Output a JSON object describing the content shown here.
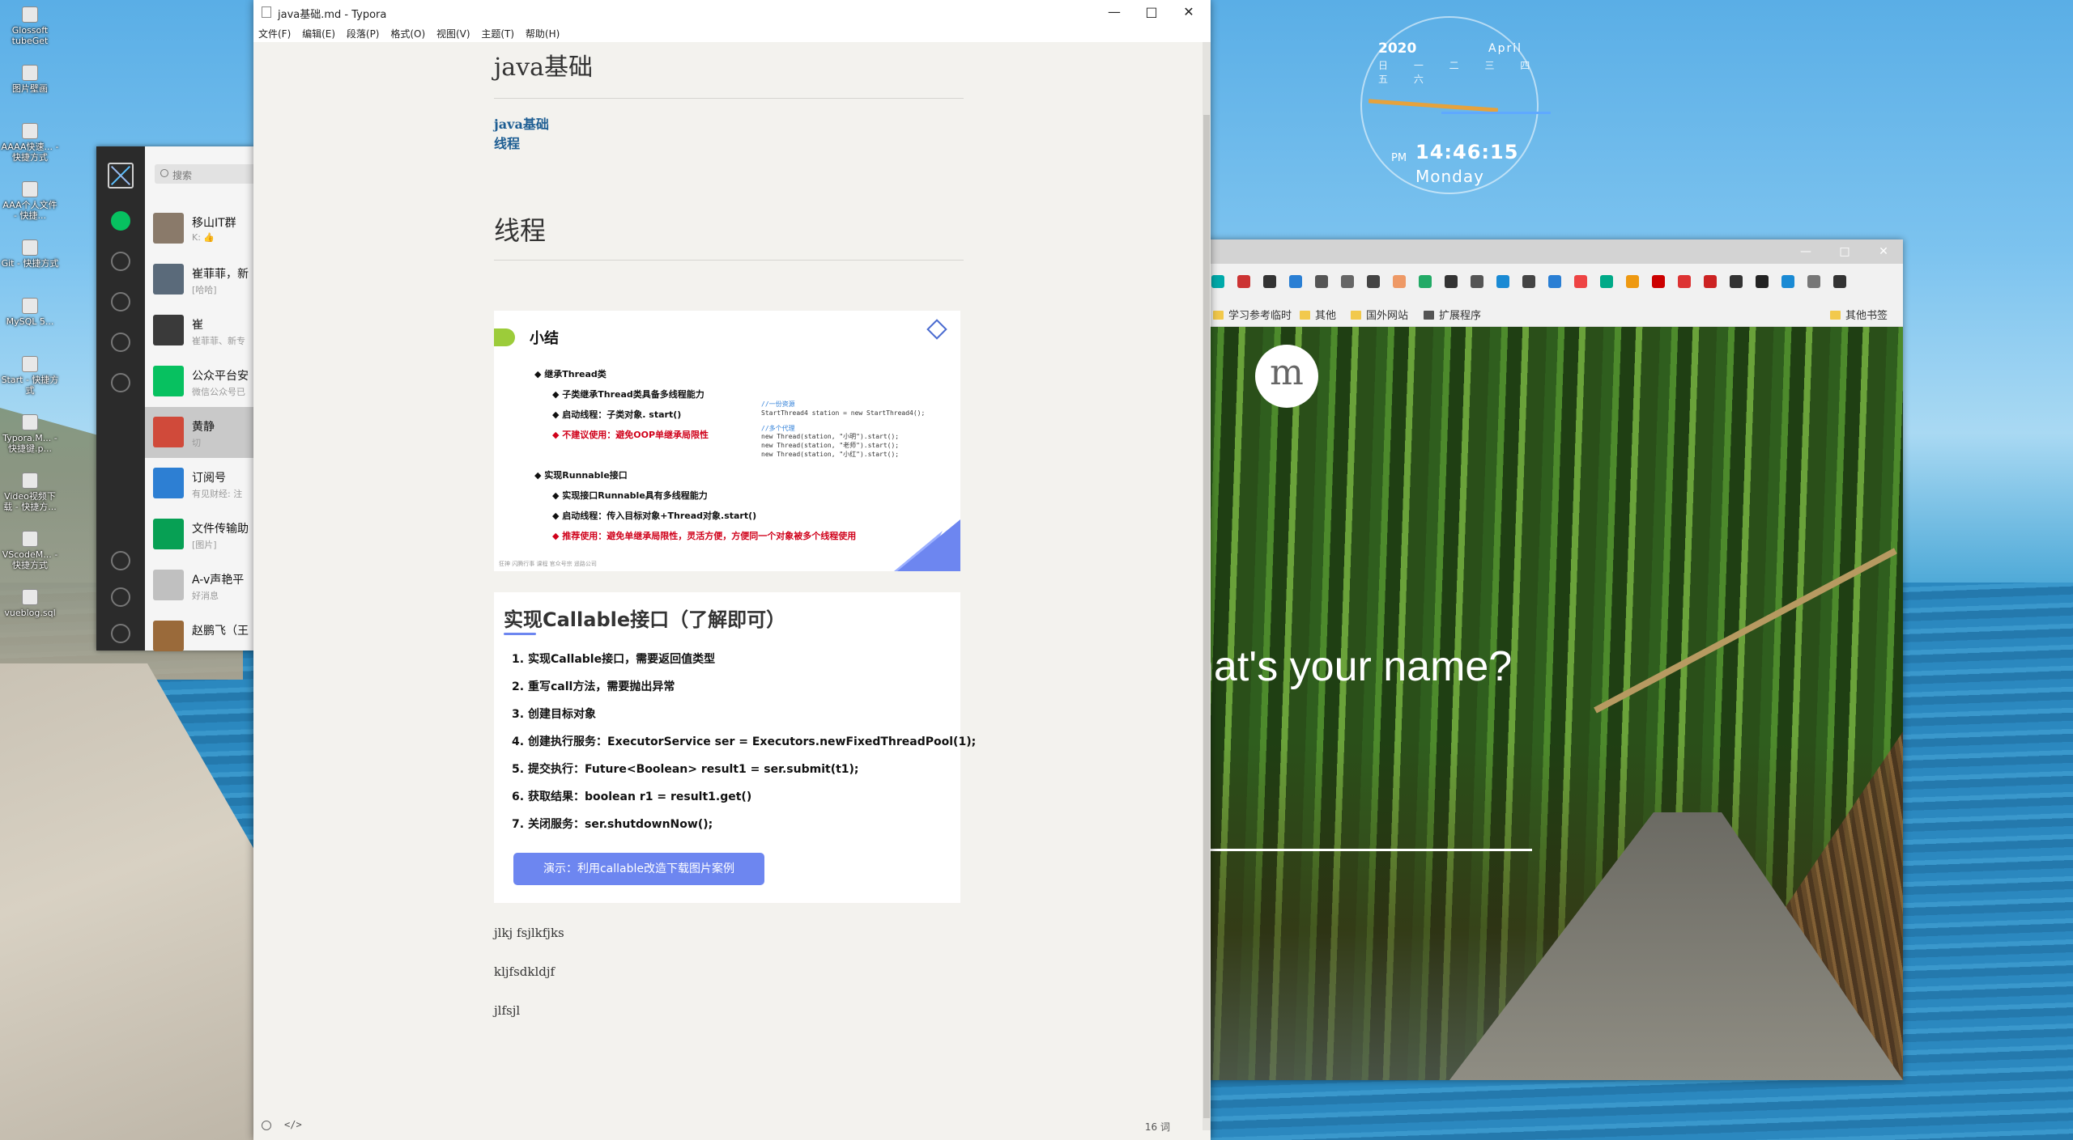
{
  "desktop": {
    "icons": [
      {
        "label": "Glossoft tubeGet"
      },
      {
        "label": "图片壁画"
      },
      {
        "label": "AAAA快速... - 快捷方式"
      },
      {
        "label": "AAA个人文件 - 快捷..."
      },
      {
        "label": "Git - 快捷方式"
      },
      {
        "label": "MySQL 5..."
      },
      {
        "label": "Start - 快捷方式"
      },
      {
        "label": "Typora.M... - 快捷键.p..."
      },
      {
        "label": "Video视频下载 - 快捷方..."
      },
      {
        "label": "VScodeM... - 快捷方式"
      },
      {
        "label": "vueblog.sql"
      }
    ]
  },
  "clock_widget": {
    "year": "2020",
    "month": "April",
    "weekdays": "日 一 二 三 四 五 六",
    "ampm": "PM",
    "time": "14:46:15",
    "day": "Monday"
  },
  "wechat": {
    "search_placeholder": "搜索",
    "chats": [
      {
        "name": "移山IT群",
        "preview": "K: 👍",
        "color": "#8a7a6a"
      },
      {
        "name": "崔菲菲，新",
        "preview": "[哈哈]",
        "color": "#5a6a7a"
      },
      {
        "name": "崔",
        "preview": "崔菲菲、新专",
        "color": "#3a3a3a"
      },
      {
        "name": "公众平台安",
        "preview": "微信公众号已",
        "color": "#07c160"
      },
      {
        "name": "黄静",
        "preview": "切",
        "color": "#d04a3a"
      },
      {
        "name": "订阅号",
        "preview": "有见财经: 注",
        "color": "#2d7fd3"
      },
      {
        "name": "文件传输助",
        "preview": "[图片]",
        "color": "#07a054"
      },
      {
        "name": "A-v声艳平",
        "preview": "好消息",
        "color": "#c0c0c0"
      },
      {
        "name": "赵鹏飞（王",
        "preview": "",
        "color": "#9a6a3a"
      }
    ]
  },
  "browser": {
    "bookmarks": [
      "学习参考临时",
      "其他",
      "国外网站",
      "扩展程序",
      "其他书签"
    ],
    "logo_letter": "m",
    "question": "hat's your name?",
    "window_controls": [
      "—",
      "□",
      "✕"
    ]
  },
  "typora": {
    "window_title": "java基础.md - Typora",
    "window_controls": [
      "—",
      "□",
      "✕"
    ],
    "menu": [
      "文件(F)",
      "编辑(E)",
      "段落(P)",
      "格式(O)",
      "视图(V)",
      "主题(T)",
      "帮助(H)"
    ],
    "h1": "java基础",
    "toc": [
      "java基础",
      "线程"
    ],
    "h1_thread": "线程",
    "slide1": {
      "title": "小结",
      "lines": [
        {
          "text": "◆ 继承Thread类",
          "red": false
        },
        {
          "text": "◆ 子类继承Thread类具备多线程能力",
          "red": false
        },
        {
          "text": "◆ 启动线程：子类对象. start()",
          "red": false
        },
        {
          "text": "◆ 不建议使用：避免OOP单继承局限性",
          "red": true
        },
        {
          "text": "◆ 实现Runnable接口",
          "red": false
        },
        {
          "text": "◆ 实现接口Runnable具有多线程能力",
          "red": false
        },
        {
          "text": "◆ 启动线程：传入目标对象+Thread对象.start()",
          "red": false
        },
        {
          "text": "◆ 推荐使用：避免单继承局限性，灵活方便，方便同一个对象被多个线程使用",
          "red": true
        }
      ],
      "code": [
        {
          "text": "//一份资源",
          "comment": true
        },
        {
          "text": "StartThread4 station = new StartThread4();",
          "comment": false
        },
        {
          "text": "//多个代理",
          "comment": true
        },
        {
          "text": "new Thread(station, \"小明\").start();",
          "comment": false
        },
        {
          "text": "new Thread(station, \"老师\").start();",
          "comment": false
        },
        {
          "text": "new Thread(station, \"小红\").start();",
          "comment": false
        }
      ],
      "footer": "狂神   闪腾行事 课程   官众号宗    遥路公司"
    },
    "slide2": {
      "title": "实现Callable接口（了解即可）",
      "items": [
        {
          "n": "1.",
          "text": "实现Callable接口，需要返回值类型"
        },
        {
          "n": "2.",
          "text": "重写call方法，需要抛出异常"
        },
        {
          "n": "3.",
          "text": "创建目标对象"
        },
        {
          "n": "4.",
          "text": "创建执行服务：ExecutorService ser = Executors.newFixedThreadPool(1);"
        },
        {
          "n": "5.",
          "text": "提交执行：Future<Boolean> result1 = ser.submit(t1);"
        },
        {
          "n": "6.",
          "text": "获取结果：boolean r1 = result1.get()"
        },
        {
          "n": "7.",
          "text": "关闭服务：ser.shutdownNow();"
        }
      ],
      "demo_button": "演示：利用callable改造下载图片案例"
    },
    "paragraphs": [
      "jlkj  fsjlkfjks",
      "kljfsdkldjf",
      "jlfsjl"
    ],
    "status_code_icon": "</>",
    "word_count": "16 词"
  }
}
